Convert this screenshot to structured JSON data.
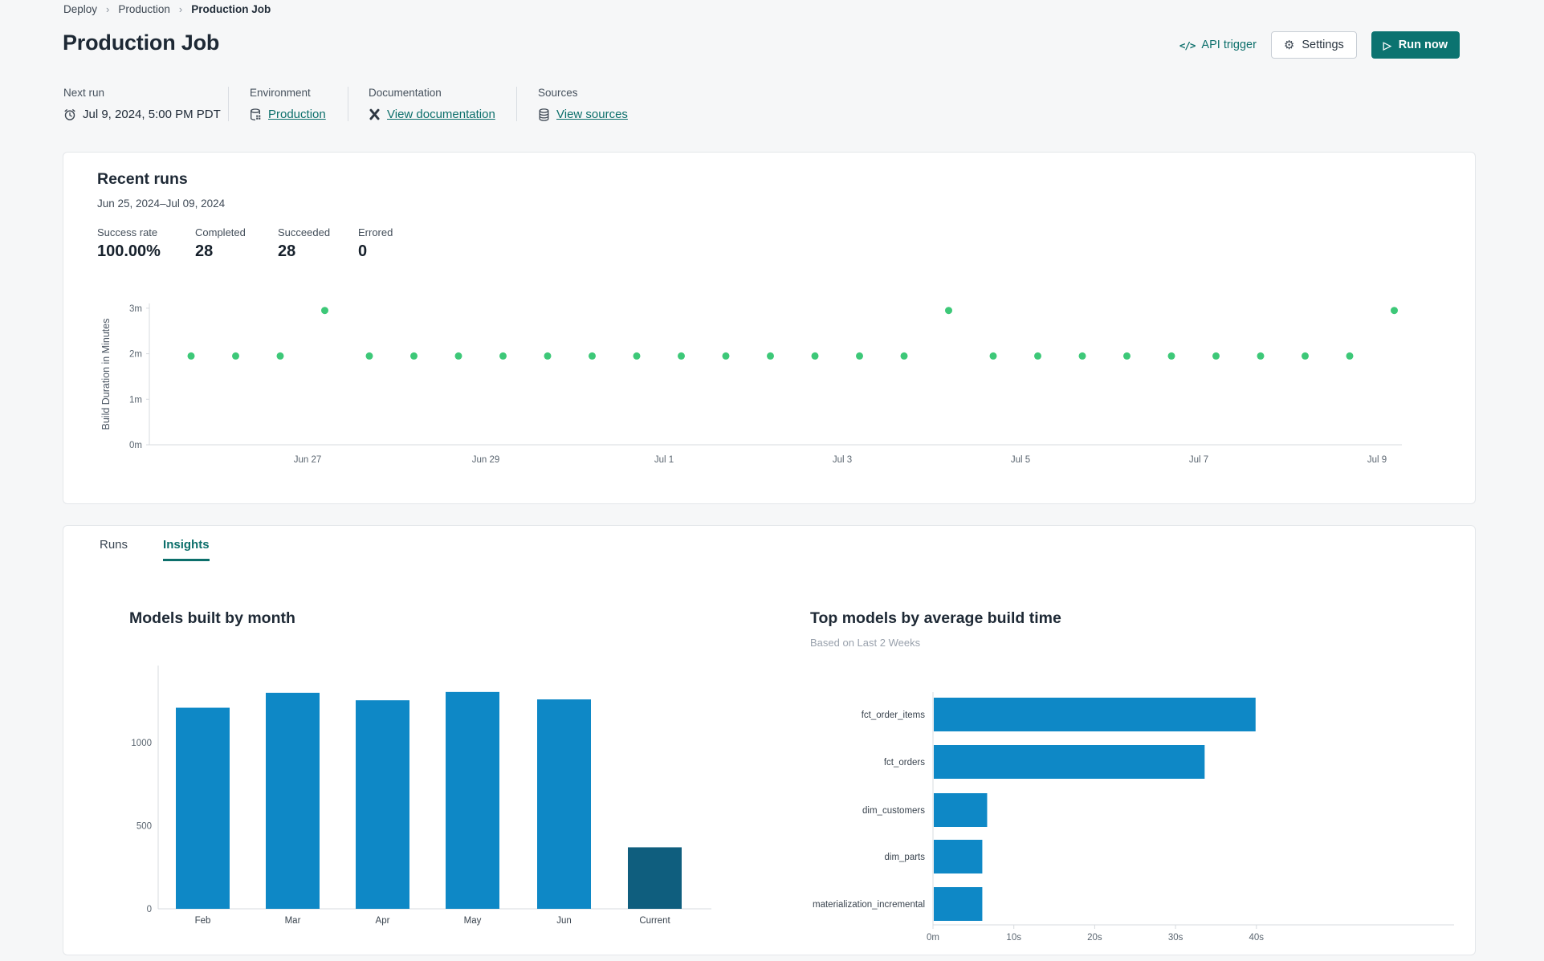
{
  "colors": {
    "teal": "#0C6F6B",
    "run_now_bg": "#0B7370",
    "dot_green": "#3DC878",
    "bar_blue": "#0E88C6",
    "bar_dark": "#0F5E7E"
  },
  "icons": {
    "gear": "⚙",
    "play": "▷",
    "code": "</>",
    "breadcrumb_sep": "›"
  },
  "breadcrumb": {
    "items": [
      "Deploy",
      "Production",
      "Production Job"
    ]
  },
  "header": {
    "title": "Production Job",
    "api_trigger_label": "API trigger",
    "settings_label": "Settings",
    "run_now_label": "Run now"
  },
  "meta": {
    "next_run": {
      "label": "Next run",
      "value": "Jul 9, 2024, 5:00 PM PDT"
    },
    "environment": {
      "label": "Environment",
      "value": "Production"
    },
    "documentation": {
      "label": "Documentation",
      "value": "View documentation"
    },
    "sources": {
      "label": "Sources",
      "value": "View sources"
    }
  },
  "recent_runs": {
    "title": "Recent runs",
    "date_range": "Jun 25, 2024–Jul 09, 2024",
    "stats": [
      {
        "label": "Success rate",
        "value": "100.00%"
      },
      {
        "label": "Completed",
        "value": "28"
      },
      {
        "label": "Succeeded",
        "value": "28"
      },
      {
        "label": "Errored",
        "value": "0"
      }
    ]
  },
  "tabs": [
    {
      "label": "Runs"
    },
    {
      "label": "Insights"
    }
  ],
  "insights": {
    "left_chart_title": "Models built by month",
    "right_chart_title": "Top models by average build time",
    "right_chart_subtitle": "Based on Last 2 Weeks"
  },
  "chart_data": [
    {
      "type": "scatter",
      "title": "Recent runs build duration",
      "ylabel": "Build Duration in Minutes",
      "y_tick_labels": [
        "0m",
        "1m",
        "2m",
        "3m"
      ],
      "ylim": [
        0,
        3.3
      ],
      "x_tick_labels": [
        "Jun 27",
        "Jun 29",
        "Jul 1",
        "Jul 3",
        "Jul 5",
        "Jul 7",
        "Jul 9"
      ],
      "runs_per_day": 2,
      "points_minutes": [
        1.95,
        1.95,
        1.95,
        2.95,
        1.95,
        1.95,
        1.95,
        1.95,
        1.95,
        1.95,
        1.95,
        1.95,
        1.95,
        1.95,
        1.95,
        1.95,
        1.95,
        2.95,
        1.95,
        1.95,
        1.95,
        1.95,
        1.95,
        1.95,
        1.95,
        1.95,
        1.95,
        2.95
      ],
      "point_color": "#3DC878",
      "grid": false,
      "legend": "none"
    },
    {
      "type": "bar",
      "title": "Models built by month",
      "categories": [
        "Feb",
        "Mar",
        "Apr",
        "May",
        "Jun",
        "Current"
      ],
      "values": [
        1210,
        1300,
        1255,
        1305,
        1260,
        370
      ],
      "y_ticks": [
        0,
        500,
        1000
      ],
      "ylim": [
        0,
        1400
      ],
      "bar_color": "#0E88C6",
      "highlight_last_color": "#0F5E7E",
      "grid": false
    },
    {
      "type": "hbar",
      "title": "Top models by average build time",
      "subtitle": "Based on Last 2 Weeks",
      "categories": [
        "fct_order_items",
        "fct_orders",
        "dim_customers",
        "dim_parts",
        "materialization_incremental"
      ],
      "values_seconds": [
        39.8,
        33.5,
        6.6,
        6.0,
        6.0
      ],
      "x_tick_labels": [
        "0m",
        "10s",
        "20s",
        "30s",
        "40s"
      ],
      "xlim_seconds": [
        0,
        45
      ],
      "bar_color": "#0E88C6",
      "grid": false
    }
  ]
}
